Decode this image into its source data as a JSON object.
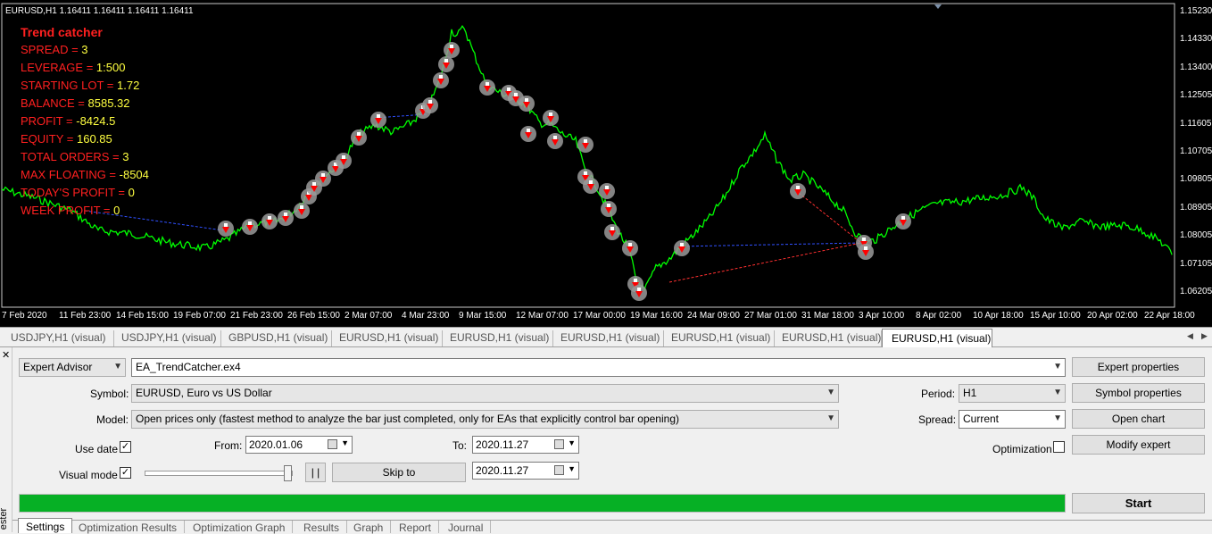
{
  "chart": {
    "symbol_header": "EURUSD,H1  1.16411 1.16411 1.16411 1.16411",
    "info_title": "Trend catcher",
    "info_rows": [
      {
        "label": "SPREAD = ",
        "value": "3"
      },
      {
        "label": "LEVERAGE = ",
        "value": "1:500"
      },
      {
        "label": "STARTING LOT = ",
        "value": "1.72"
      },
      {
        "label": "BALANCE = ",
        "value": "8585.32"
      },
      {
        "label": "PROFIT = ",
        "value": "-8424.5"
      },
      {
        "label": "EQUITY = ",
        "value": "160.85"
      },
      {
        "label": "TOTAL ORDERS = ",
        "value": "3"
      },
      {
        "label": "MAX FLOATING = ",
        "value": "-8504"
      },
      {
        "label": "TODAY'S PROFIT = ",
        "value": "0"
      },
      {
        "label": "WEEK PROFIT = ",
        "value": "0"
      }
    ],
    "price_ticks": [
      "1.15230",
      "1.14330",
      "1.13400",
      "1.12505",
      "1.11605",
      "1.10705",
      "1.09805",
      "1.08905",
      "1.08005",
      "1.07105",
      "1.06205"
    ],
    "date_ticks": [
      "7 Feb 2020",
      "11 Feb 23:00",
      "14 Feb 15:00",
      "19 Feb 07:00",
      "21 Feb 23:00",
      "26 Feb 15:00",
      "2 Mar 07:00",
      "4 Mar 23:00",
      "9 Mar 15:00",
      "12 Mar 07:00",
      "17 Mar 00:00",
      "19 Mar 16:00",
      "24 Mar 09:00",
      "27 Mar 01:00",
      "31 Mar 18:00",
      "3 Apr 10:00",
      "8 Apr 02:00",
      "10 Apr 18:00",
      "15 Apr 10:00",
      "20 Apr 02:00",
      "22 Apr 18:00"
    ],
    "colors": {
      "background": "#000000",
      "price_line": "#00ff00",
      "info_label": "#ff2020",
      "info_value": "#ffff40",
      "buy_marker": "#ff0000",
      "sell_marker": "#ff0000"
    }
  },
  "chart_tabs": [
    {
      "label": "USDJPY,H1 (visual)"
    },
    {
      "label": "USDJPY,H1 (visual)"
    },
    {
      "label": "GBPUSD,H1 (visual)"
    },
    {
      "label": "EURUSD,H1 (visual)"
    },
    {
      "label": "EURUSD,H1 (visual)"
    },
    {
      "label": "EURUSD,H1 (visual)"
    },
    {
      "label": "EURUSD,H1 (visual)"
    },
    {
      "label": "EURUSD,H1 (visual)"
    },
    {
      "label": "EURUSD,H1 (visual)",
      "active": true
    }
  ],
  "tester": {
    "side_label": "ester",
    "type_select": "Expert Advisor",
    "expert_file": "EA_TrendCatcher.ex4",
    "symbol_label": "Symbol:",
    "symbol_value": "EURUSD, Euro vs US Dollar",
    "model_label": "Model:",
    "model_value": "Open prices only (fastest method to analyze the bar just completed, only for EAs that explicitly control bar opening)",
    "period_label": "Period:",
    "period_value": "H1",
    "spread_label": "Spread:",
    "spread_value": "Current",
    "use_date_label": "Use date",
    "use_date_checked": "✓",
    "from_label": "From:",
    "from_value": "2020.01.06",
    "to_label": "To:",
    "to_value": "2020.11.27",
    "visual_mode_label": "Visual mode",
    "visual_mode_checked": "✓",
    "pause_label": "| |",
    "skip_to_label": "Skip to",
    "skip_to_value": "2020.11.27",
    "optimization_label": "Optimization",
    "buttons": {
      "expert_properties": "Expert properties",
      "symbol_properties": "Symbol properties",
      "open_chart": "Open chart",
      "modify_expert": "Modify expert",
      "start": "Start"
    },
    "progress_percent": 100,
    "progress_color": "#06b025"
  },
  "bottom_tabs": [
    {
      "label": "Settings",
      "active": true
    },
    {
      "label": "Optimization Results"
    },
    {
      "label": "Optimization Graph"
    },
    {
      "label": "Results"
    },
    {
      "label": "Graph"
    },
    {
      "label": "Report"
    },
    {
      "label": "Journal"
    }
  ]
}
